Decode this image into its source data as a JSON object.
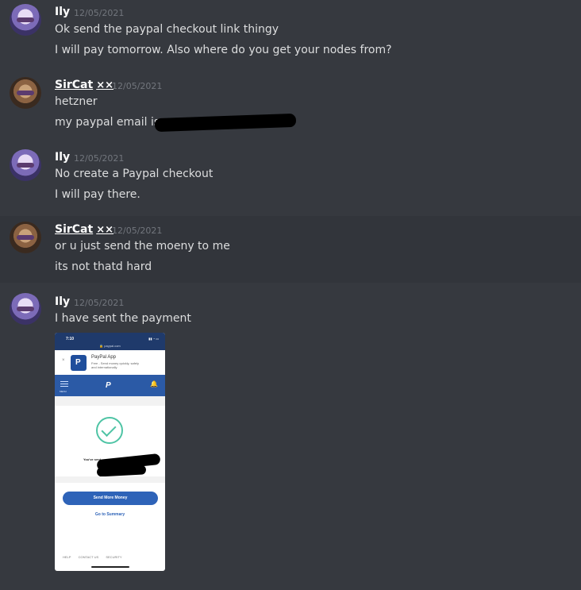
{
  "messages": [
    {
      "user": "Ily",
      "timestamp": "12/05/2021",
      "lines": [
        "Ok send the paypal checkout link thingy",
        "I will pay tomorrow. Also where do you get your nodes from?"
      ]
    },
    {
      "user": "SirCat",
      "badge": "××",
      "timestamp": "12/05/2021",
      "lines": [
        "hetzner",
        "my paypal email is"
      ]
    },
    {
      "user": "Ily",
      "timestamp": "12/05/2021",
      "lines": [
        "No create a Paypal checkout",
        "I will pay there."
      ]
    },
    {
      "user": "SirCat",
      "badge": "××",
      "timestamp": "12/05/2021",
      "lines": [
        "or u just send the moeny to me",
        "its not thatd hard"
      ]
    },
    {
      "user": "Ily",
      "timestamp": "12/05/2021",
      "lines": [
        "I have sent the payment"
      ]
    }
  ],
  "attachment": {
    "status_time": "7:10",
    "url": "🔒 paypal.com",
    "app_name": "PayPal App",
    "app_desc": "Free - Send money quickly, safely and internationally",
    "menu_label": "MENU",
    "sent_text": "You've sent",
    "primary_button": "Send More Money",
    "secondary_link": "Go to Summary",
    "footer": [
      "HELP",
      "CONTACT US",
      "SECURITY"
    ]
  },
  "colors": {
    "background": "#36393f",
    "paypal_blue": "#2b5aa6",
    "check_green": "#4fc4a5"
  }
}
